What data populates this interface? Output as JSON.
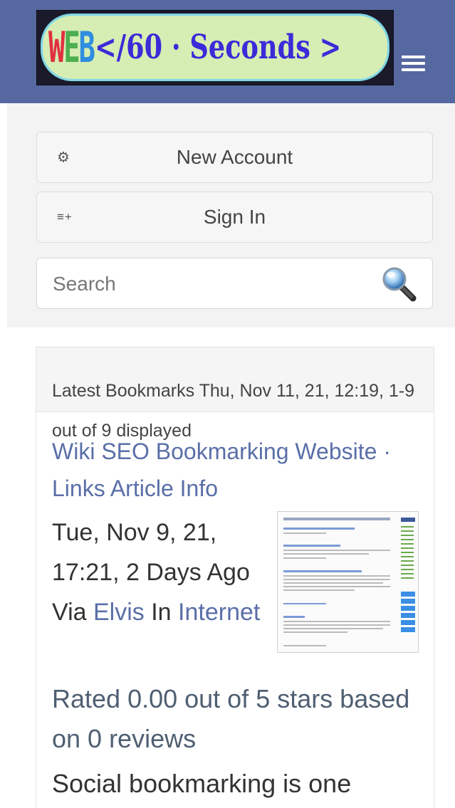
{
  "header": {
    "logo": {
      "web_letters": [
        "W",
        "E",
        "B"
      ],
      "rest": "</60 · Seconds >"
    },
    "menu_icon": "hamburger-menu-icon"
  },
  "account": {
    "new_account_label": "New Account",
    "new_account_icon": "gear-icon",
    "sign_in_label": "Sign In",
    "sign_in_icon": "list-add-icon",
    "search_placeholder": "Search",
    "search_icon": "magnifier-icon"
  },
  "main": {
    "latest_header": "Latest Bookmarks Thu, Nov 11, 21, 12:19, 1-9 out of 9 displayed",
    "bookmark": {
      "title": "Wiki SEO Bookmarking Website · Links Article Info",
      "date_text": "Tue, Nov 9, 21, 17:21, 2 Days Ago Via ",
      "author": "Elvis",
      "in_text": " In ",
      "category": "Internet",
      "rating": "Rated 0.00 out of 5 stars based on 0 reviews",
      "excerpt": "Social bookmarking is one"
    }
  },
  "colors": {
    "navbar": "#5668a0",
    "link": "#5a6fa8",
    "logo_text": "#3b2bd8",
    "logo_pill": "#d6edb4"
  }
}
